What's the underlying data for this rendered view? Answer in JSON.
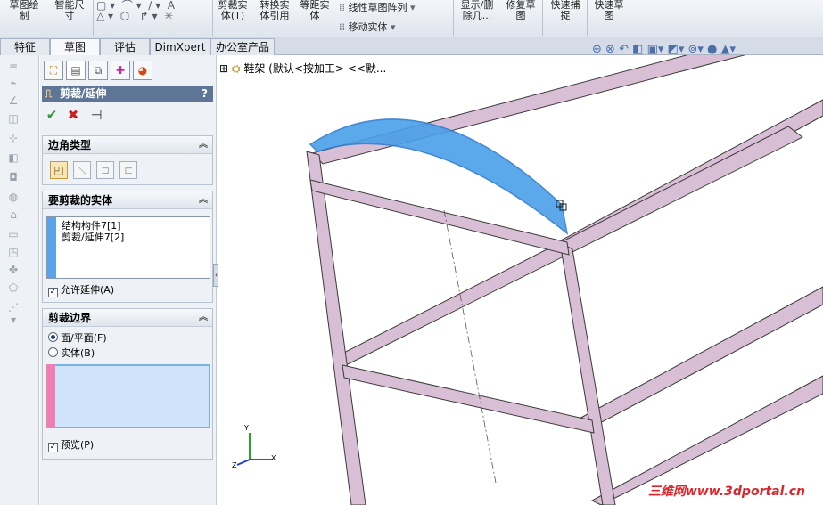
{
  "ribbon": {
    "buttons": [
      {
        "label": "草图绘\n制",
        "id": "sketch"
      },
      {
        "label": "智能尺\n寸",
        "id": "smart-dim"
      },
      {
        "label": "剪裁实\n体(T)",
        "id": "trim"
      },
      {
        "label": "转换实\n体引用",
        "id": "convert"
      },
      {
        "label": "等距实\n体",
        "id": "offset"
      },
      {
        "label": "线性草图阵列",
        "id": "linear-pattern"
      },
      {
        "label": "移动实体",
        "id": "move"
      },
      {
        "label": "显示/删\n除几...",
        "id": "display-delete"
      },
      {
        "label": "修复草\n图",
        "id": "repair"
      },
      {
        "label": "快速捕\n捉",
        "id": "quick-snap"
      },
      {
        "label": "快速草\n图",
        "id": "rapid-sketch"
      }
    ]
  },
  "tabs": [
    {
      "label": "特征",
      "active": false
    },
    {
      "label": "草图",
      "active": true
    },
    {
      "label": "评估",
      "active": false
    },
    {
      "label": "DimXpert",
      "active": false
    },
    {
      "label": "办公室产品",
      "active": false
    }
  ],
  "property_manager": {
    "title": "剪裁/延伸",
    "help": "?",
    "ok": "✔",
    "cancel": "✖",
    "pin": "⊣",
    "corner_type": {
      "heading": "边角类型",
      "options": [
        "end-trim",
        "end-miter",
        "end-butt1",
        "end-butt2"
      ]
    },
    "bodies": {
      "heading": "要剪裁的实体",
      "items": [
        "结构构件7[1]",
        "剪裁/延伸7[2]"
      ],
      "allow_extend": "允许延伸(A)",
      "allow_extend_checked": true
    },
    "boundary": {
      "heading": "剪裁边界",
      "face_plane": "面/平面(F)",
      "body": "实体(B)",
      "selected": "face_plane",
      "preview": "预览(P)",
      "preview_checked": true
    }
  },
  "tree": {
    "root": "鞋架 (默认<按加工> <<默..."
  },
  "triad": {
    "x": "X",
    "y": "Y",
    "z": "Z"
  },
  "watermark": "三维网www.3dportal.cn",
  "colors": {
    "title_bar": "#5f7595",
    "highlight_blue": "#4a9fe8",
    "member_pink": "#d9bfd6",
    "boundary_pink": "#ef7fb1",
    "bodies_bar": "#5aa3e9"
  }
}
